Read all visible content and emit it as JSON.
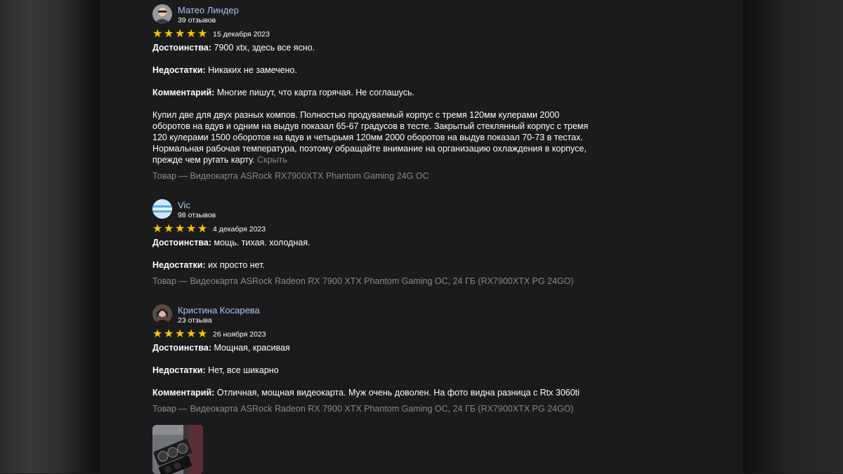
{
  "reviews": [
    {
      "author": "Матео Линдер",
      "reviews_count": "39 отзывов",
      "rating": 5,
      "date": "15 декабря 2023",
      "pros_label": "Достоинства:",
      "pros": "7900 xtx, здесь все ясно.",
      "cons_label": "Недостатки:",
      "cons": "Никаких не замечено.",
      "comment_label": "Комментарий:",
      "comment": "Многие пишут, что карта горячая. Не соглашусь.",
      "comment_lines": [
        "Купил две для двух разных компов. Полностью продуваемый корпус с тремя 120мм кулерами 2000",
        "оборотов на вдув и одним на выдув показал 65-67 градусов в тесте. Закрытый стеклянный корпус с тремя",
        "120 кулерами 1500 оборотов на вдув и четырьмя 120мм 2000 оборотов на выдув показал 70-73 в тестах.",
        "Нормальная рабочая температура, поэтому обращайте внимание на организацию охлаждения в корпусе,",
        "прежде чем ругать карту."
      ],
      "hide_label": "Скрыть",
      "product": "Товар — Видеокарта ASRock RX7900XTX Phantom Gaming 24G OC"
    },
    {
      "author": "Vic",
      "reviews_count": "98 отзывов",
      "rating": 5,
      "date": "4 декабря 2023",
      "pros_label": "Достоинства:",
      "pros": "мощь. тихая. холодная.",
      "cons_label": "Недостатки:",
      "cons": "их просто нет.",
      "product": "Товар — Видеокарта ASRock Radeon RX 7900 XTX Phantom Gaming OC, 24 ГБ (RX7900XTX PG 24GO)"
    },
    {
      "author": "Кристина Косарева",
      "reviews_count": "23 отзыва",
      "rating": 5,
      "date": "26 ноября 2023",
      "pros_label": "Достоинства:",
      "pros": "Мощная, красивая",
      "cons_label": "Недостатки:",
      "cons": "Нет, все шикарно",
      "comment_label": "Комментарий:",
      "comment": "Отличная, мощная видеокарта. Муж очень доволен. На фото видна разница с Rtx 3060ti",
      "product": "Товар — Видеокарта ASRock Radeon RX 7900 XTX Phantom Gaming OC, 24 ГБ (RX7900XTX PG 24GO)"
    }
  ],
  "colors": {
    "background": "#1b1b1d",
    "text": "#ffffff",
    "author_link": "#a6c8f2",
    "muted": "#8a8a8a",
    "star": "#f7c600"
  }
}
